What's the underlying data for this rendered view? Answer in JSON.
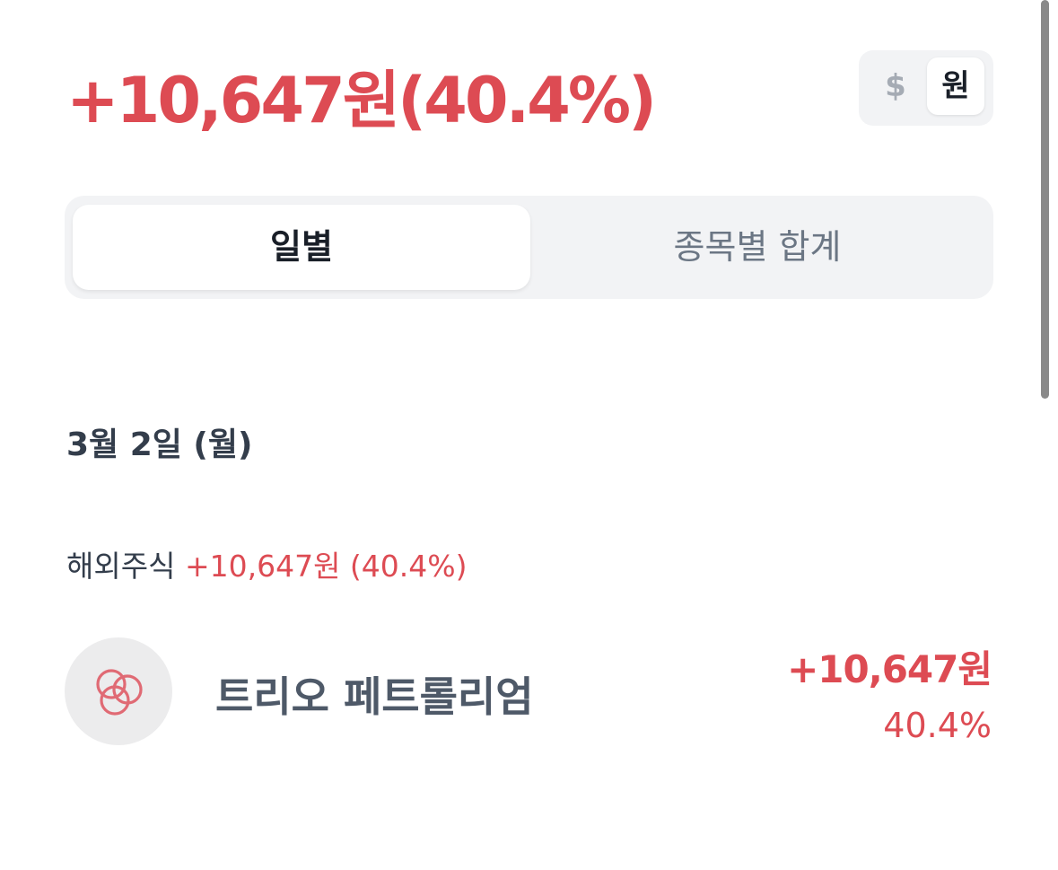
{
  "summary": {
    "total_profit": "+10,647원(40.4%)"
  },
  "currency_toggle": {
    "dollar_label": "$",
    "won_label": "원",
    "selected": "원"
  },
  "tabs": {
    "daily_label": "일별",
    "by_stock_total_label": "종목별 합계",
    "selected": "일별"
  },
  "day": {
    "date_label": "3월 2일 (월)",
    "category": {
      "name": "해외주식",
      "profit": "+10,647원 (40.4%)"
    },
    "stocks": [
      {
        "name": "트리오 페트롤리엄",
        "amount": "+10,647원",
        "rate": "40.4%",
        "logo_icon": "trio-petroleum-logo-icon"
      }
    ]
  },
  "colors": {
    "profit_red": "#dd4b53",
    "text_dark": "#191f28",
    "text_gray": "#6b7684",
    "segment_bg": "#f2f3f5"
  }
}
